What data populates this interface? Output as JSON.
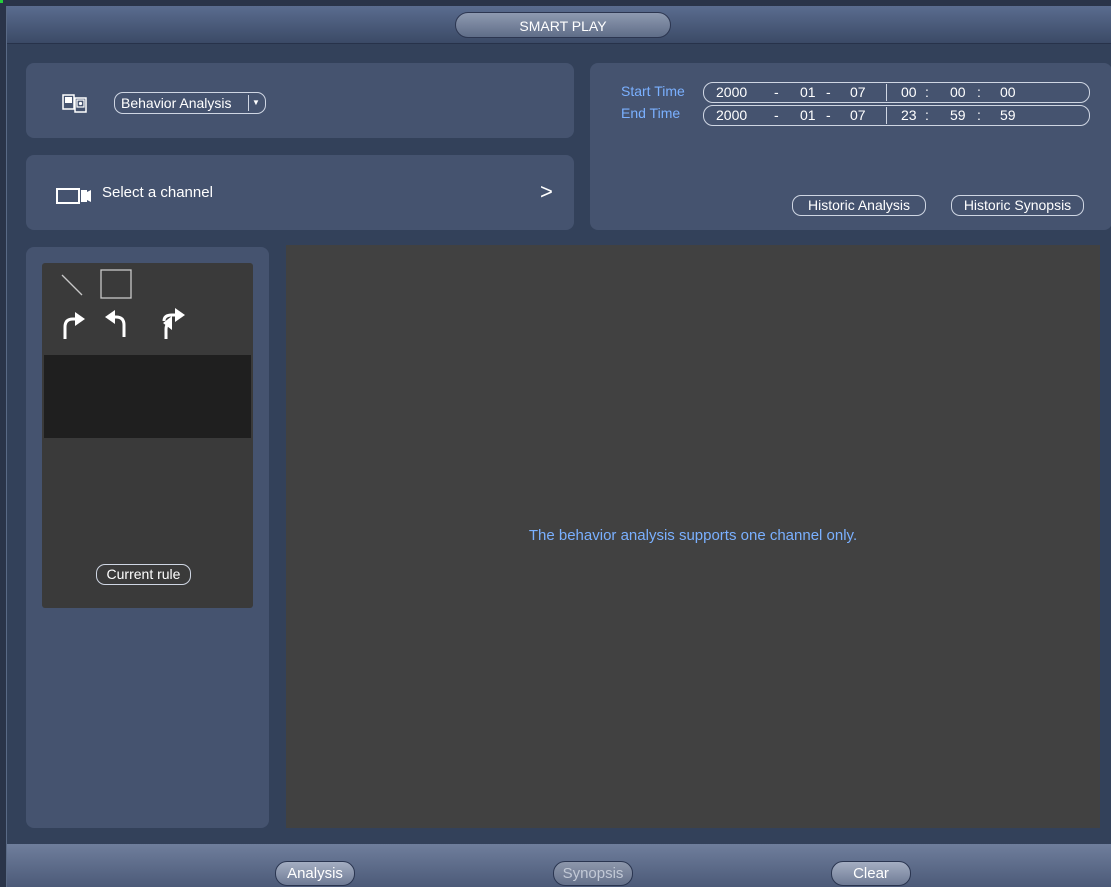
{
  "window": {
    "title": "SMART PLAY"
  },
  "analysis_type": {
    "selected": "Behavior Analysis",
    "icon": "analysis-type-icon"
  },
  "channel": {
    "label": "Select a channel",
    "icon": "camera-icon"
  },
  "time": {
    "start_label": "Start Time",
    "end_label": "End Time",
    "start": {
      "year": "2000",
      "month": "01",
      "day": "07",
      "hour": "00",
      "minute": "00",
      "second": "00"
    },
    "end": {
      "year": "2000",
      "month": "01",
      "day": "07",
      "hour": "23",
      "minute": "59",
      "second": "59"
    },
    "date_sep": "-",
    "time_sep": ":"
  },
  "buttons": {
    "historic_analysis": "Historic Analysis",
    "historic_synopsis": "Historic Synopsis",
    "current_rule": "Current rule"
  },
  "rule_tools": [
    "line-draw-icon",
    "rectangle-draw-icon",
    "turn-right-icon",
    "turn-left-icon",
    "u-turn-icon"
  ],
  "video": {
    "message": "The behavior analysis supports one channel only."
  },
  "bottom": {
    "analysis": "Analysis",
    "synopsis": "Synopsis",
    "clear": "Clear"
  },
  "colors": {
    "accent_text": "#7ab0ff",
    "panel": "#45536f",
    "background": "#33415a"
  }
}
